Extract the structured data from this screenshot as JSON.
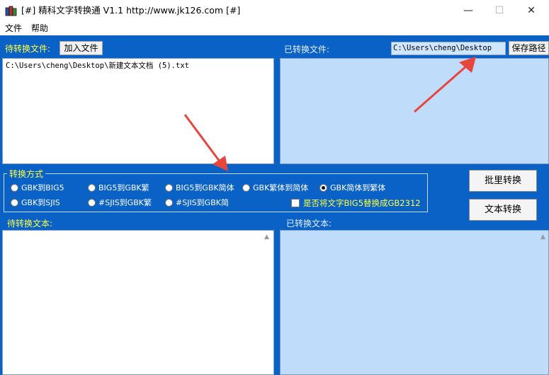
{
  "window": {
    "title": "[#] 精科文字转换通 V1.1  http://www.jk126.com [#]",
    "minimize": "—",
    "maximize": "☐",
    "close": "✕"
  },
  "menu": {
    "items": [
      "文件",
      "帮助"
    ]
  },
  "source_files": {
    "label": "待转换文件:",
    "add_button": "加入文件",
    "items": [
      "C:\\Users\\cheng\\Desktop\\新建文本文档 (5).txt"
    ]
  },
  "output_files": {
    "label": "已转换文件:",
    "save_path": "C:\\Users\\cheng\\Desktop",
    "save_button": "保存路径"
  },
  "convert_mode": {
    "title": "转换方式",
    "options": [
      "GBK到BIG5",
      "BIG5到GBK繁",
      "BIG5到GBK简体",
      "GBK繁体到简体",
      "GBK简体到繁体",
      "GBK到SJIS",
      "#SJIS到GBK繁",
      "#SJIS到GBK简"
    ],
    "selected": "GBK简体到繁体",
    "checkbox_label": "是否将文字BIG5替换成GB2312",
    "checkbox_checked": false
  },
  "actions": {
    "batch": "批里转换",
    "text": "文本转换"
  },
  "source_text": {
    "label": "待转换文本:",
    "value": ""
  },
  "output_text": {
    "label": "已转换文本:",
    "value": ""
  },
  "colors": {
    "client_bg": "#0b62c6",
    "label_yellow": "#ffff40",
    "output_box": "#bfdcfb",
    "arrow": "#e8453c"
  }
}
